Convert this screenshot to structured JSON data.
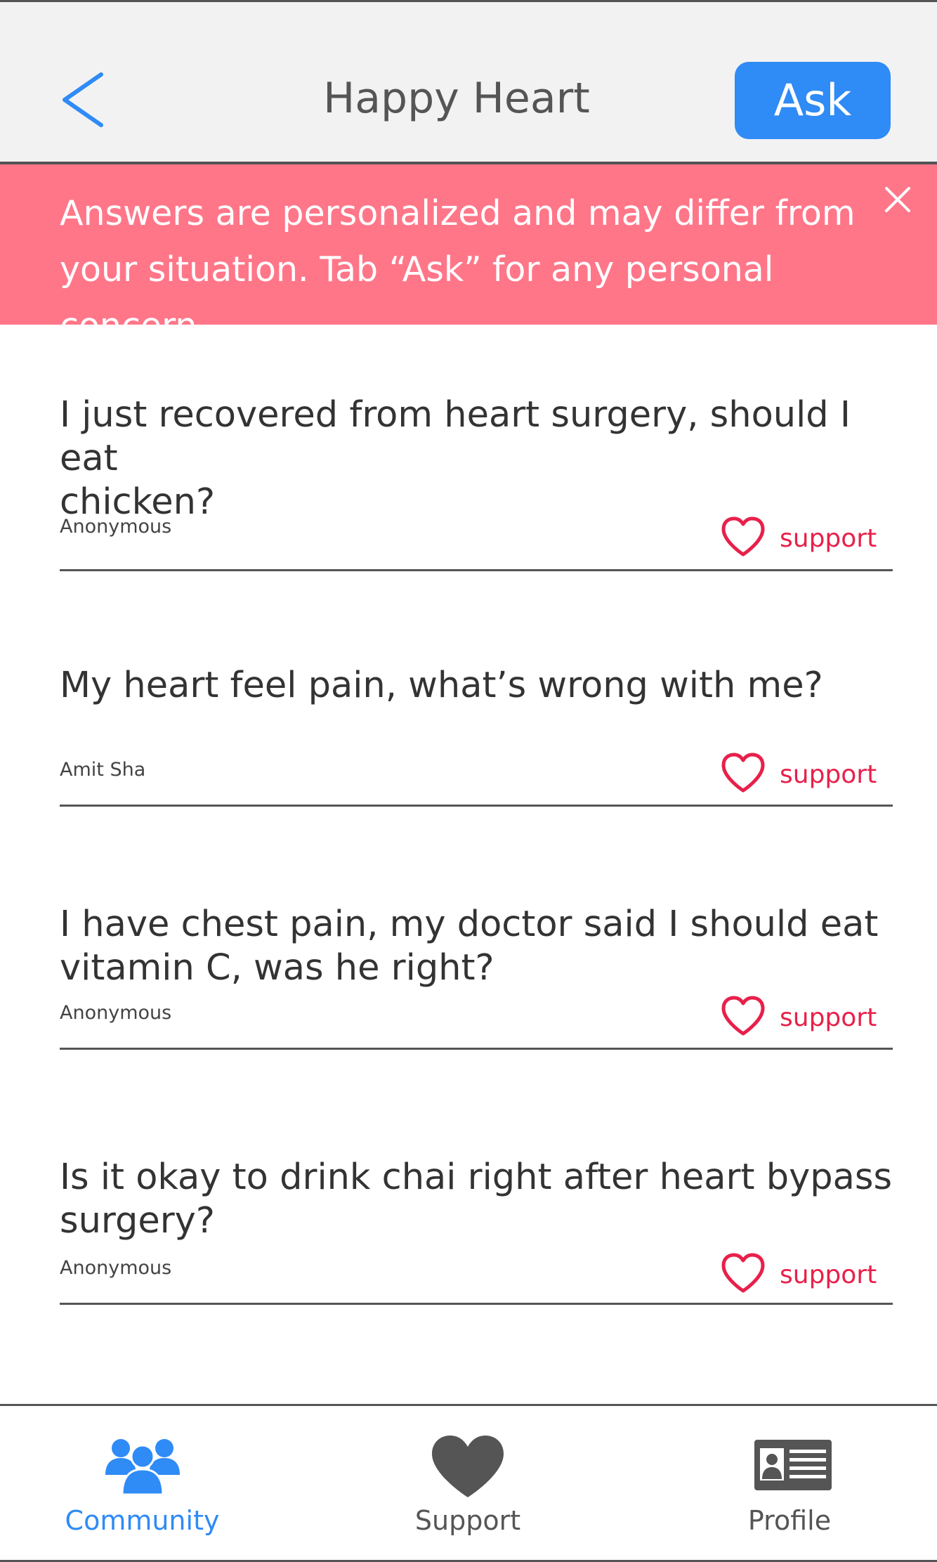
{
  "header": {
    "title": "Happy Heart",
    "back_icon": "chevron-left-icon",
    "ask_label": "Ask",
    "accent_color": "#2f8bf5"
  },
  "banner": {
    "line1": "Answers are personalized and may differ from",
    "line2": "your situation. Tab “Ask” for any personal concern.",
    "close_icon": "close-icon",
    "color": "#ff7689"
  },
  "posts": [
    {
      "question_line1": "I just recovered from heart surgery, should I eat",
      "question_line2": "chicken?",
      "author": "Anonymous",
      "support_label": "support"
    },
    {
      "question_line1": "My heart feel pain, what’s wrong with me?",
      "question_line2": "",
      "author": "Amit Sha",
      "support_label": "support"
    },
    {
      "question_line1": "I have chest pain, my doctor said I should eat",
      "question_line2": "vitamin C, was he right?",
      "author": "Anonymous",
      "support_label": "support"
    },
    {
      "question_line1": "Is it okay to drink chai right after heart bypass",
      "question_line2": "surgery?",
      "author": "Anonymous",
      "support_label": "support"
    }
  ],
  "support_color": "#e8204a",
  "tabs": [
    {
      "label": "Community",
      "icon": "community-icon",
      "active": true
    },
    {
      "label": "Support",
      "icon": "heart-icon",
      "active": false
    },
    {
      "label": "Profile",
      "icon": "id-card-icon",
      "active": false
    }
  ]
}
